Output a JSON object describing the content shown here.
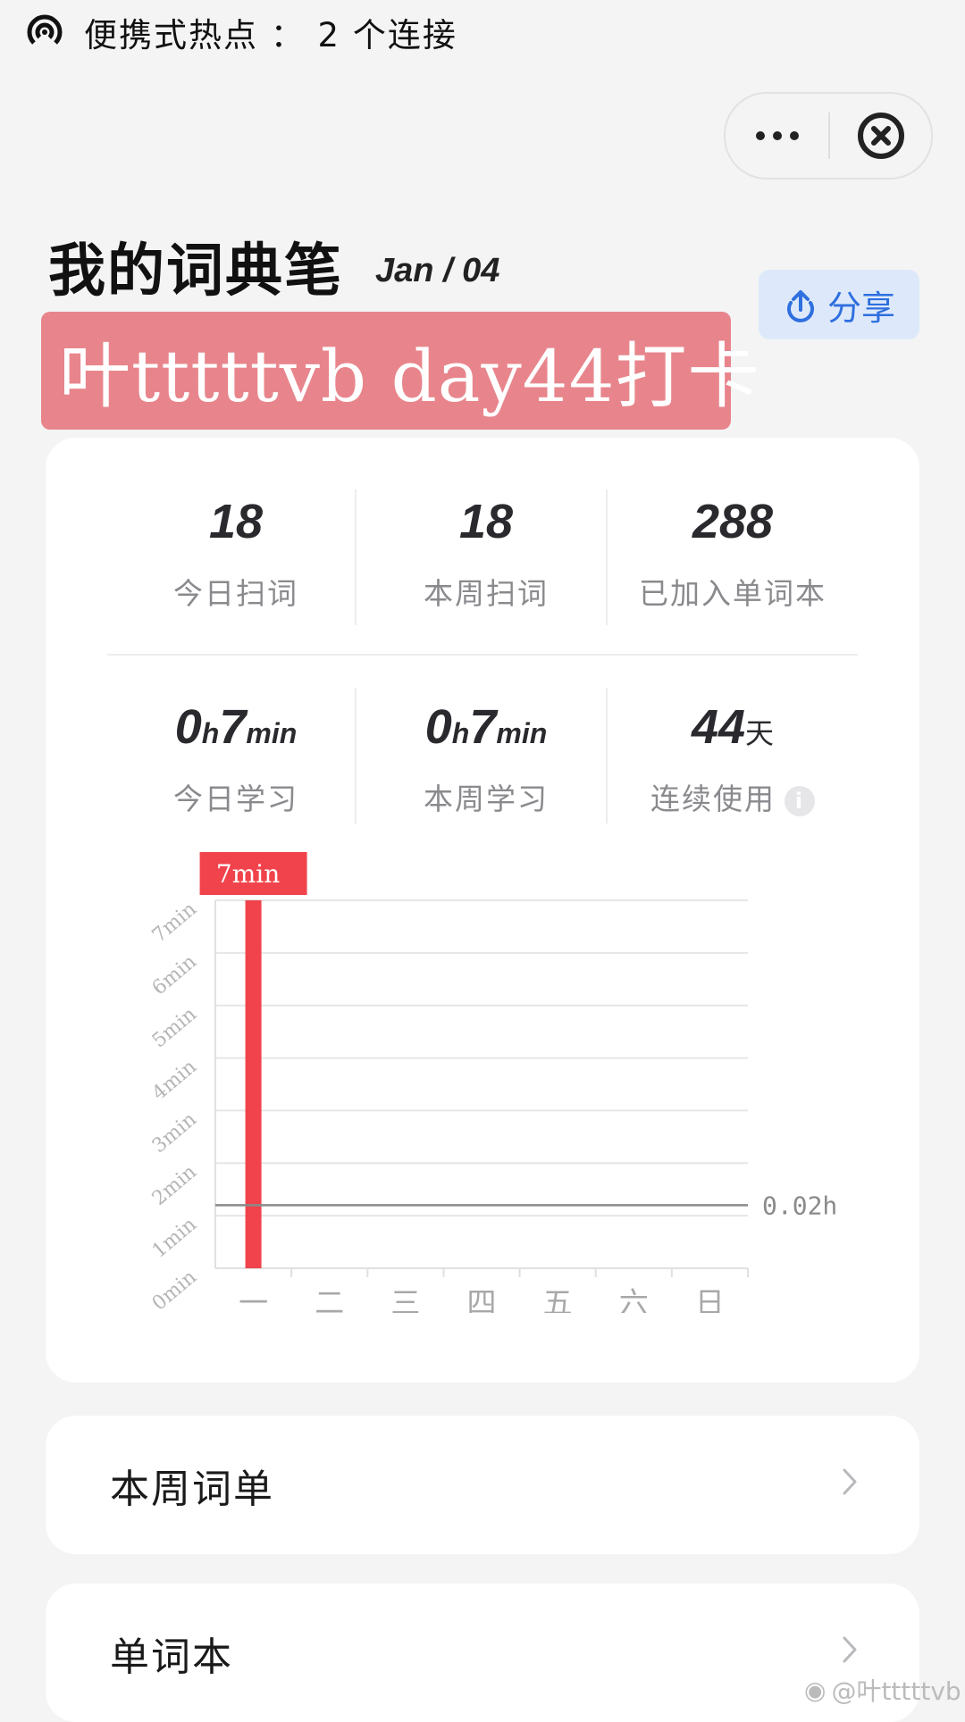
{
  "status_bar": {
    "hotspot_text": "便携式热点 ： 2 个连接"
  },
  "capsule": {
    "more_icon": "more-dots-icon",
    "close_icon": "close-circle-icon"
  },
  "header": {
    "title": "我的词典笔",
    "date": "Jan / 04"
  },
  "share": {
    "label": "分享",
    "icon": "upload-share-icon"
  },
  "banner": {
    "text": "叶tttttvb day44打卡",
    "color": "#e8858c"
  },
  "stats": {
    "row1": [
      {
        "value": "18",
        "caption": "今日扫词"
      },
      {
        "value": "18",
        "caption": "本周扫词"
      },
      {
        "value": "288",
        "caption": "已加入单词本"
      }
    ],
    "row2": [
      {
        "h": "0",
        "h_unit": "h",
        "m": "7",
        "m_unit": "min",
        "caption": "今日学习"
      },
      {
        "h": "0",
        "h_unit": "h",
        "m": "7",
        "m_unit": "min",
        "caption": "本周学习"
      },
      {
        "value": "44",
        "unit": "天",
        "caption": "连续使用",
        "info_icon": "info-icon"
      }
    ]
  },
  "chart_data": {
    "type": "bar",
    "categories": [
      "一",
      "二",
      "三",
      "四",
      "五",
      "六",
      "日"
    ],
    "values": [
      7,
      0,
      0,
      0,
      0,
      0,
      0
    ],
    "yticks": [
      "0min",
      "1min",
      "2min",
      "3min",
      "4min",
      "5min",
      "6min",
      "7min"
    ],
    "ylim": [
      0,
      7
    ],
    "bar_label": "7min",
    "reference_line": {
      "value": 1.2,
      "label": "0.02h"
    },
    "bar_color": "#f0434b",
    "grid": true
  },
  "links": [
    {
      "label": "本周词单"
    },
    {
      "label": "单词本"
    }
  ],
  "watermark": {
    "text": "@叶tttttvb"
  }
}
